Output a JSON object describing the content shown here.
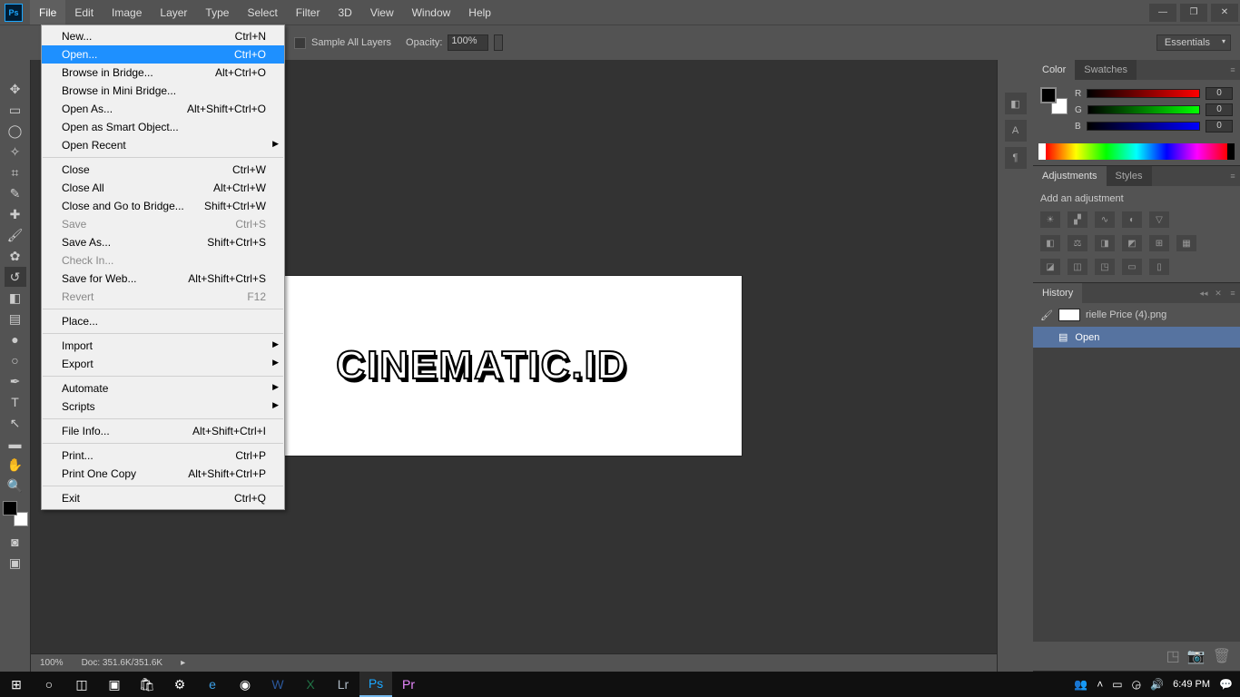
{
  "app": {
    "logo": "Ps"
  },
  "menubar": [
    "File",
    "Edit",
    "Image",
    "Layer",
    "Type",
    "Select",
    "Filter",
    "3D",
    "View",
    "Window",
    "Help"
  ],
  "menubar_active": 0,
  "options": {
    "sample_all": "Sample All Layers",
    "opacity_label": "Opacity:",
    "opacity_value": "100%",
    "workspace": "Essentials"
  },
  "file_menu": [
    {
      "label": "New...",
      "short": "Ctrl+N"
    },
    {
      "label": "Open...",
      "short": "Ctrl+O",
      "hl": true
    },
    {
      "label": "Browse in Bridge...",
      "short": "Alt+Ctrl+O"
    },
    {
      "label": "Browse in Mini Bridge..."
    },
    {
      "label": "Open As...",
      "short": "Alt+Shift+Ctrl+O"
    },
    {
      "label": "Open as Smart Object..."
    },
    {
      "label": "Open Recent",
      "sub": true
    },
    {
      "sep": true
    },
    {
      "label": "Close",
      "short": "Ctrl+W"
    },
    {
      "label": "Close All",
      "short": "Alt+Ctrl+W"
    },
    {
      "label": "Close and Go to Bridge...",
      "short": "Shift+Ctrl+W"
    },
    {
      "label": "Save",
      "short": "Ctrl+S",
      "dis": true
    },
    {
      "label": "Save As...",
      "short": "Shift+Ctrl+S"
    },
    {
      "label": "Check In...",
      "dis": true
    },
    {
      "label": "Save for Web...",
      "short": "Alt+Shift+Ctrl+S"
    },
    {
      "label": "Revert",
      "short": "F12",
      "dis": true
    },
    {
      "sep": true
    },
    {
      "label": "Place..."
    },
    {
      "sep": true
    },
    {
      "label": "Import",
      "sub": true
    },
    {
      "label": "Export",
      "sub": true
    },
    {
      "sep": true
    },
    {
      "label": "Automate",
      "sub": true
    },
    {
      "label": "Scripts",
      "sub": true
    },
    {
      "sep": true
    },
    {
      "label": "File Info...",
      "short": "Alt+Shift+Ctrl+I"
    },
    {
      "sep": true
    },
    {
      "label": "Print...",
      "short": "Ctrl+P"
    },
    {
      "label": "Print One Copy",
      "short": "Alt+Shift+Ctrl+P"
    },
    {
      "sep": true
    },
    {
      "label": "Exit",
      "short": "Ctrl+Q"
    }
  ],
  "canvas": {
    "text": "CINEMATIC.ID"
  },
  "color_panel": {
    "tabs": [
      "Color",
      "Swatches"
    ],
    "r": "0",
    "g": "0",
    "b": "0"
  },
  "adjustments": {
    "tabs": [
      "Adjustments",
      "Styles"
    ],
    "title": "Add an adjustment"
  },
  "history": {
    "tabs": [
      "History"
    ],
    "doc": "rielle Price (4).png",
    "step": "Open"
  },
  "status": {
    "zoom": "100%",
    "doc": "Doc:  351.6K/351.6K"
  },
  "taskbar": {
    "time": "6:49 PM"
  }
}
